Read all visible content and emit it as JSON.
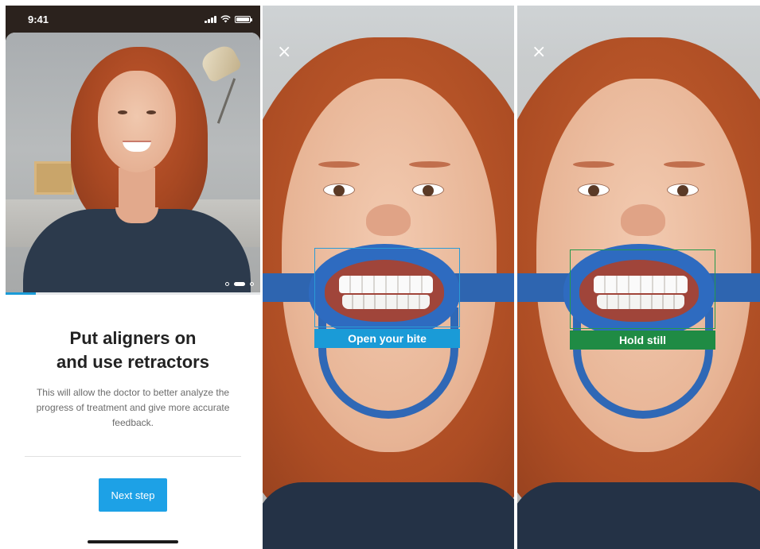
{
  "panel_onboarding": {
    "status_time": "9:41",
    "carousel": {
      "page_count": 3,
      "active_index": 1
    },
    "progress_fraction": 0.12,
    "title_line1": "Put aligners on",
    "title_line2": "and use retractors",
    "description": "This will allow the doctor to better analyze the progress of treatment and give more accurate feedback.",
    "next_button_label": "Next step",
    "colors": {
      "accent": "#1da1e6",
      "title": "#222222",
      "body": "#6b6b6b"
    }
  },
  "panel_open_bite": {
    "close_icon": "close-icon",
    "instruction_label": "Open your bite",
    "colors": {
      "frame": "#2a9bd6",
      "label_bg": "#1a9bd7"
    }
  },
  "panel_hold_still": {
    "close_icon": "close-icon",
    "instruction_label": "Hold still",
    "colors": {
      "frame": "#239a4c",
      "label_bg": "#1f8b44"
    }
  }
}
